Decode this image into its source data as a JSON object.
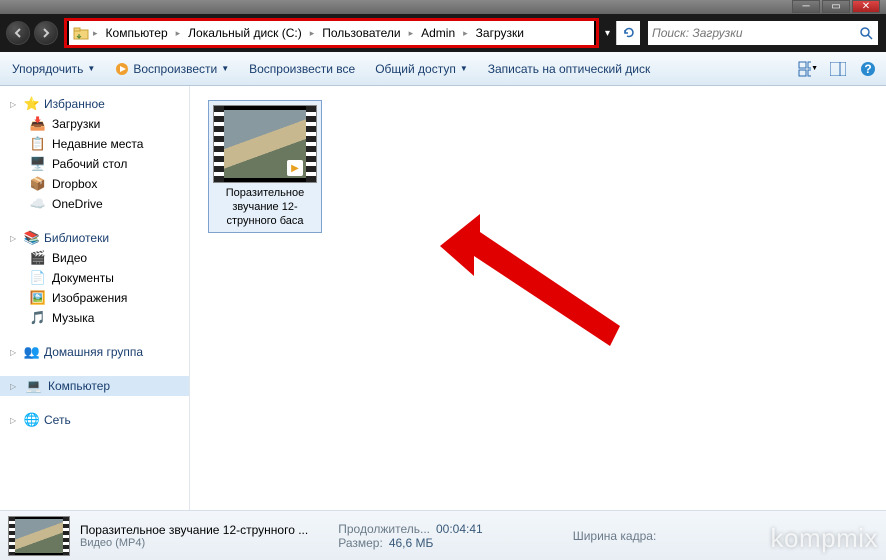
{
  "breadcrumb": {
    "items": [
      "Компьютер",
      "Локальный диск (C:)",
      "Пользователи",
      "Admin",
      "Загрузки"
    ]
  },
  "search": {
    "placeholder": "Поиск: Загрузки"
  },
  "toolbar": {
    "organize": "Упорядочить",
    "play": "Воспроизвести",
    "playall": "Воспроизвести все",
    "share": "Общий доступ",
    "burn": "Записать на оптический диск"
  },
  "sidebar": {
    "favorites": {
      "label": "Избранное",
      "items": [
        {
          "icon": "download-icon",
          "label": "Загрузки"
        },
        {
          "icon": "recent-icon",
          "label": "Недавние места"
        },
        {
          "icon": "desktop-icon",
          "label": "Рабочий стол"
        },
        {
          "icon": "dropbox-icon",
          "label": "Dropbox"
        },
        {
          "icon": "onedrive-icon",
          "label": "OneDrive"
        }
      ]
    },
    "libraries": {
      "label": "Библиотеки",
      "items": [
        {
          "icon": "video-icon",
          "label": "Видео"
        },
        {
          "icon": "doc-icon",
          "label": "Документы"
        },
        {
          "icon": "image-icon",
          "label": "Изображения"
        },
        {
          "icon": "music-icon",
          "label": "Музыка"
        }
      ]
    },
    "homegroup": {
      "label": "Домашняя группа"
    },
    "computer": {
      "label": "Компьютер"
    },
    "network": {
      "label": "Сеть"
    }
  },
  "file": {
    "name": "Поразительное звучание 12-струнного баса"
  },
  "status": {
    "title": "Поразительное звучание 12-струнного ...",
    "type": "Видео (MP4)",
    "duration_label": "Продолжитель...",
    "duration": "00:04:41",
    "size_label": "Размер:",
    "size": "46,6 МБ",
    "width_label": "Ширина кадра:"
  },
  "watermark": "kompmix"
}
